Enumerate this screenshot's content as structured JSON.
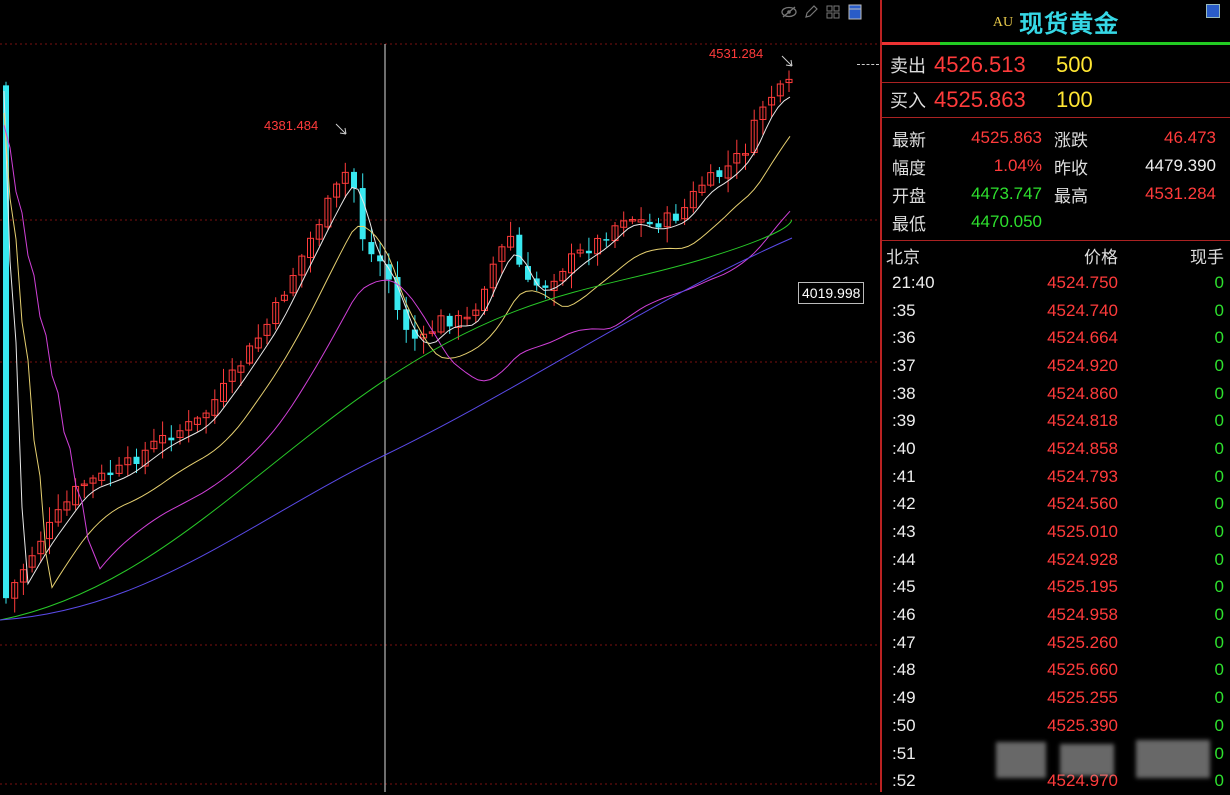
{
  "header": {
    "symbol": "AU",
    "title": "现货黄金"
  },
  "quote": {
    "sell_label": "卖出",
    "sell_price": "4526.513",
    "sell_volume": "500",
    "buy_label": "买入",
    "buy_price": "4525.863",
    "buy_volume": "100"
  },
  "stats": [
    {
      "k1": "最新",
      "v1": "4525.863",
      "c1": "red",
      "k2": "涨跌",
      "v2": "46.473",
      "c2": "red"
    },
    {
      "k1": "幅度",
      "v1": "1.04%",
      "c1": "red",
      "k2": "昨收",
      "v2": "4479.390",
      "c2": "white"
    },
    {
      "k1": "开盘",
      "v1": "4473.747",
      "c1": "green",
      "k2": "最高",
      "v2": "4531.284",
      "c2": "red"
    },
    {
      "k1": "最低",
      "v1": "4470.050",
      "c1": "green",
      "k2": "",
      "v2": "",
      "c2": "white"
    }
  ],
  "ticks": {
    "col_time": "北京",
    "col_price": "价格",
    "col_qty": "现手",
    "rows": [
      {
        "time": "21:40",
        "price": "4524.750",
        "qty": "0"
      },
      {
        "time": ":35",
        "price": "4524.740",
        "qty": "0"
      },
      {
        "time": ":36",
        "price": "4524.664",
        "qty": "0"
      },
      {
        "time": ":37",
        "price": "4524.920",
        "qty": "0"
      },
      {
        "time": ":38",
        "price": "4524.860",
        "qty": "0"
      },
      {
        "time": ":39",
        "price": "4524.818",
        "qty": "0"
      },
      {
        "time": ":40",
        "price": "4524.858",
        "qty": "0"
      },
      {
        "time": ":41",
        "price": "4524.793",
        "qty": "0"
      },
      {
        "time": ":42",
        "price": "4524.560",
        "qty": "0"
      },
      {
        "time": ":43",
        "price": "4525.010",
        "qty": "0"
      },
      {
        "time": ":44",
        "price": "4524.928",
        "qty": "0"
      },
      {
        "time": ":45",
        "price": "4525.195",
        "qty": "0"
      },
      {
        "time": ":46",
        "price": "4524.958",
        "qty": "0"
      },
      {
        "time": ":47",
        "price": "4525.260",
        "qty": "0"
      },
      {
        "time": ":48",
        "price": "4525.660",
        "qty": "0"
      },
      {
        "time": ":49",
        "price": "4525.255",
        "qty": "0"
      },
      {
        "time": ":50",
        "price": "4525.390",
        "qty": "0"
      },
      {
        "time": ":51",
        "price": "",
        "qty": "0"
      },
      {
        "time": ":52",
        "price": "4524.970",
        "qty": "0"
      }
    ]
  },
  "chart": {
    "high_label": "4531.284",
    "peak_label": "4381.484",
    "crosshair_price": "4019.998",
    "toolbar_icons": [
      "eye-off-icon",
      "pencil-icon",
      "grid-icon",
      "layout-icon"
    ]
  },
  "colors": {
    "up": "#ff3b3b",
    "down": "#38e8f0",
    "ma5": "#e8e8e8",
    "ma10": "#e6d070",
    "ma20": "#d040d8",
    "ma60": "#28c828",
    "ma120": "#5a4ae8"
  }
}
